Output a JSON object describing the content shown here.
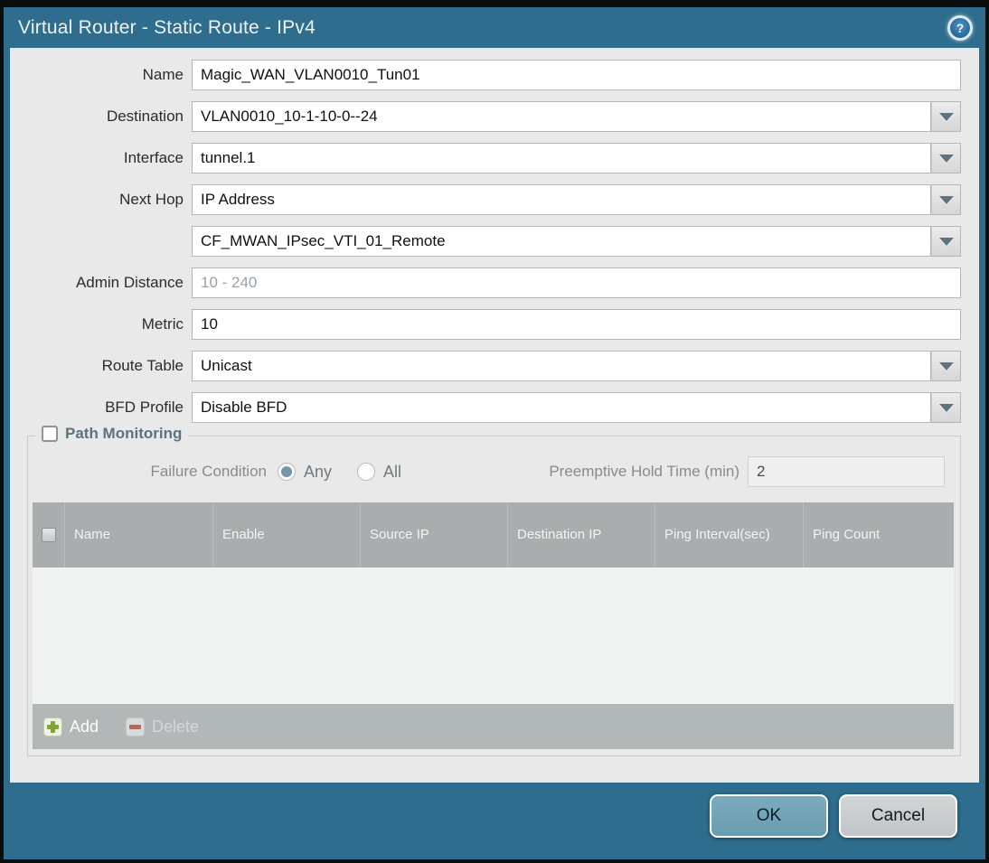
{
  "window": {
    "title": "Virtual Router - Static Route - IPv4",
    "help_glyph": "?"
  },
  "form": {
    "name": {
      "label": "Name",
      "value": "Magic_WAN_VLAN0010_Tun01"
    },
    "destination": {
      "label": "Destination",
      "value": "VLAN0010_10-1-10-0--24"
    },
    "interface": {
      "label": "Interface",
      "value": "tunnel.1"
    },
    "next_hop": {
      "label": "Next Hop",
      "value": "IP Address"
    },
    "next_hop_address": {
      "value": "CF_MWAN_IPsec_VTI_01_Remote"
    },
    "admin_distance": {
      "label": "Admin Distance",
      "placeholder": "10 - 240",
      "value": ""
    },
    "metric": {
      "label": "Metric",
      "value": "10"
    },
    "route_table": {
      "label": "Route Table",
      "value": "Unicast"
    },
    "bfd_profile": {
      "label": "BFD Profile",
      "value": "Disable BFD"
    }
  },
  "path_monitoring": {
    "title": "Path Monitoring",
    "checked": false,
    "failure_condition": {
      "label": "Failure Condition",
      "options": [
        "Any",
        "All"
      ],
      "selected": "Any"
    },
    "preemptive_hold_time": {
      "label": "Preemptive Hold Time (min)",
      "value": "2"
    },
    "table": {
      "columns": [
        "Name",
        "Enable",
        "Source IP",
        "Destination IP",
        "Ping Interval(sec)",
        "Ping Count"
      ],
      "rows": []
    },
    "toolbar": {
      "add_label": "Add",
      "delete_label": "Delete",
      "delete_enabled": false
    }
  },
  "footer": {
    "ok_label": "OK",
    "cancel_label": "Cancel"
  },
  "colors": {
    "frame_teal": "#2e6d8d",
    "content_bg": "#e9e9e9",
    "table_header_bg": "#a9adad",
    "table_footer_bg": "#b2b7b7",
    "ok_button_bg": "#6fa1b6",
    "cancel_button_bg": "#c9cccd",
    "add_icon_green": "#7fa33a",
    "delete_icon_red": "#b06a5f",
    "radio_selected_fill": "#7496aa",
    "pm_title_color": "#5b7380"
  }
}
